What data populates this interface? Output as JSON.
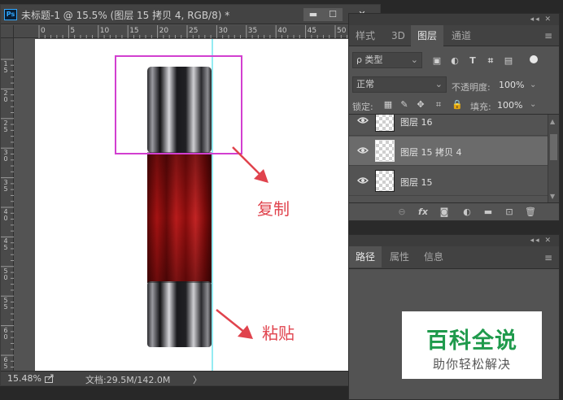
{
  "document": {
    "title": "未标题-1 @ 15.5% (图层 15 拷贝 4, RGB/8) *",
    "app_icon": "Ps",
    "ruler_top_labels": [
      "0",
      "5",
      "10",
      "15",
      "20",
      "25",
      "30",
      "35",
      "40",
      "45",
      "50"
    ],
    "ruler_left_labels": [
      "1\n5",
      "2\n0",
      "2\n5",
      "3\n0",
      "3\n5",
      "4\n0",
      "4\n5",
      "5\n0",
      "5\n5",
      "6\n0",
      "6\n5"
    ],
    "status": {
      "zoom": "15.48%",
      "doc_size": "文档:29.5M/142.0M",
      "arrow": "〉"
    }
  },
  "layers_panel": {
    "tabs": [
      "样式",
      "3D",
      "图层",
      "通道"
    ],
    "active_tab": "图层",
    "filter_kind": "ρ 类型",
    "blend_mode": "正常",
    "opacity_label": "不透明度:",
    "opacity_value": "100%",
    "lock_label": "锁定:",
    "fill_label": "填充:",
    "fill_value": "100%",
    "layers": [
      {
        "name": "图层 16",
        "visible": true,
        "selected": false
      },
      {
        "name": "图层 15 拷贝 4",
        "visible": true,
        "selected": true
      },
      {
        "name": "图层 15",
        "visible": true,
        "selected": false
      }
    ],
    "footer_icons": [
      "link-icon",
      "fx-icon",
      "mask-icon",
      "adjustment-icon",
      "folder-icon",
      "new-layer-icon",
      "trash-icon"
    ],
    "fx_label": "fx"
  },
  "paths_panel": {
    "tabs": [
      "路径",
      "属性",
      "信息"
    ],
    "active_tab": "路径"
  },
  "annotations": {
    "copy_label": "复制",
    "paste_label": "粘贴",
    "color": "#e0434d"
  },
  "watermark": {
    "title": "百科全说",
    "subtitle": "助你轻松解决",
    "color": "#1f9a4c"
  },
  "colors": {
    "selection_box": "#d23fd0",
    "guide": "#2ad7e6",
    "tube_red": "#b01515"
  }
}
